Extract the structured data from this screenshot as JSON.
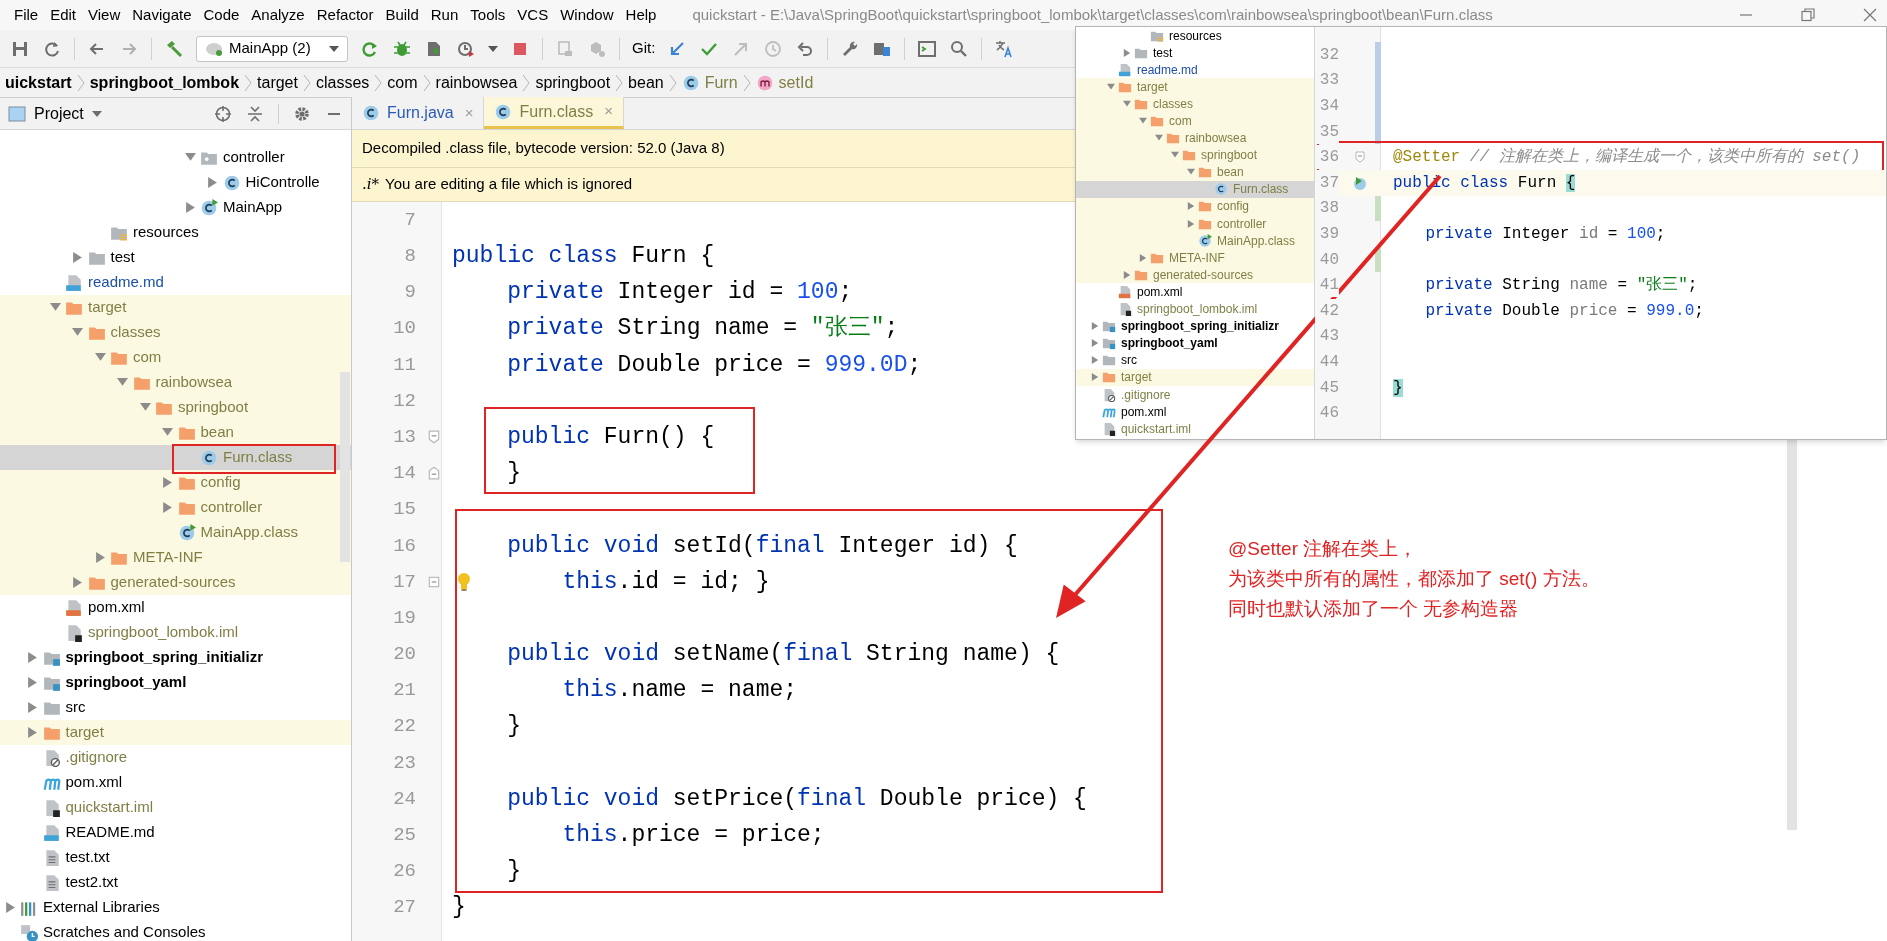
{
  "menu": [
    {
      "label": "File"
    },
    {
      "label": "Edit"
    },
    {
      "label": "View"
    },
    {
      "label": "Navigate"
    },
    {
      "label": "Code"
    },
    {
      "label": "Analyze"
    },
    {
      "label": "Refactor"
    },
    {
      "label": "Build"
    },
    {
      "label": "Run"
    },
    {
      "label": "Tools"
    },
    {
      "label": "VCS"
    },
    {
      "label": "Window"
    },
    {
      "label": "Help"
    }
  ],
  "window_title": "quickstart - E:\\Java\\SpringBoot\\quickstart\\springboot_lombok\\target\\classes\\com\\rainbowsea\\springboot\\bean\\Furn.class",
  "toolbar": {
    "run_config": "MainApp (2)",
    "git_label": "Git:"
  },
  "breadcrumbs": [
    {
      "label": "uickstart",
      "kind": "module"
    },
    {
      "label": "springboot_lombok",
      "kind": "module"
    },
    {
      "label": "target",
      "kind": "folder"
    },
    {
      "label": "classes",
      "kind": "folder"
    },
    {
      "label": "com",
      "kind": "folder"
    },
    {
      "label": "rainbowsea",
      "kind": "folder"
    },
    {
      "label": "springboot",
      "kind": "folder"
    },
    {
      "label": "bean",
      "kind": "folder"
    },
    {
      "label": "Furn",
      "kind": "class"
    },
    {
      "label": "setId",
      "kind": "method"
    }
  ],
  "project_panel": {
    "title": "Project",
    "tree": [
      {
        "children": [
          {
            "children": [
              {
                "children": [
                  {
                    "children": [
                      {
                        "children": [
                          {
                            "children": [
                              {
                                "children": [
                                  {
                                    "children": [
                                      {
                                        "label": "controller",
                                        "kind": "package",
                                        "expanded": true,
                                        "selected": false,
                                        "children": [
                                          {
                                            "label": "HiControlle",
                                            "kind": "class",
                                            "expanded": false,
                                            "selected": false
                                          }
                                        ]
                                      },
                                      {
                                        "label": "MainApp",
                                        "kind": "main-class",
                                        "expanded": false,
                                        "selected": false
                                      }
                                    ]
                                  }
                                ]
                              }
                            ]
                          }
                        ]
                      },
                      {
                        "label": "resources",
                        "kind": "resources-folder",
                        "selected": false
                      }
                    ]
                  },
                  {
                    "label": "test",
                    "kind": "folder",
                    "expanded": false,
                    "selected": false
                  }
                ]
              },
              {
                "label": "readme.md",
                "kind": "markdown",
                "vcs_added": true,
                "selected": false
              },
              {
                "label": "target",
                "kind": "folder",
                "excluded": true,
                "expanded": true,
                "selected": false,
                "children": [
                  {
                    "label": "classes",
                    "kind": "folder",
                    "excluded": true,
                    "expanded": true,
                    "selected": false,
                    "children": [
                      {
                        "label": "com",
                        "kind": "folder",
                        "excluded": true,
                        "expanded": true,
                        "selected": false,
                        "children": [
                          {
                            "label": "rainbowsea",
                            "kind": "folder",
                            "excluded": true,
                            "expanded": true,
                            "selected": false,
                            "children": [
                              {
                                "label": "springboot",
                                "kind": "folder",
                                "excluded": true,
                                "expanded": true,
                                "selected": false,
                                "children": [
                                  {
                                    "label": "bean",
                                    "kind": "folder",
                                    "excluded": true,
                                    "expanded": true,
                                    "selected": false,
                                    "children": [
                                      {
                                        "label": "Furn.class",
                                        "kind": "class",
                                        "excluded": true,
                                        "selected": true
                                      }
                                    ]
                                  },
                                  {
                                    "label": "config",
                                    "kind": "folder",
                                    "excluded": true,
                                    "expanded": false,
                                    "selected": false
                                  },
                                  {
                                    "label": "controller",
                                    "kind": "folder",
                                    "excluded": true,
                                    "expanded": false,
                                    "selected": false
                                  },
                                  {
                                    "label": "MainApp.class",
                                    "kind": "main-class",
                                    "excluded": true,
                                    "selected": false
                                  }
                                ]
                              }
                            ]
                          }
                        ]
                      },
                      {
                        "label": "META-INF",
                        "kind": "folder",
                        "excluded": true,
                        "expanded": false,
                        "selected": false
                      }
                    ]
                  },
                  {
                    "label": "generated-sources",
                    "kind": "folder",
                    "excluded": true,
                    "expanded": false,
                    "selected": false
                  }
                ]
              },
              {
                "label": "pom.xml",
                "kind": "xml",
                "selected": false
              },
              {
                "label": "springboot_lombok.iml",
                "kind": "iml",
                "ignored": true,
                "selected": false
              }
            ]
          },
          {
            "label": "springboot_spring_initializr",
            "kind": "module",
            "expanded": false,
            "selected": false
          },
          {
            "label": "springboot_yaml",
            "kind": "module",
            "expanded": false,
            "selected": false
          },
          {
            "label": "src",
            "kind": "folder",
            "expanded": false,
            "selected": false
          },
          {
            "label": "target",
            "kind": "folder",
            "excluded": true,
            "expanded": false,
            "selected": false
          },
          {
            "label": ".gitignore",
            "kind": "gitignore",
            "ignored": true,
            "selected": false
          },
          {
            "label": "pom.xml",
            "kind": "maven",
            "selected": false
          },
          {
            "label": "quickstart.iml",
            "kind": "iml",
            "ignored": true,
            "selected": false
          },
          {
            "label": "README.md",
            "kind": "markdown",
            "selected": false
          },
          {
            "label": "test.txt",
            "kind": "text",
            "selected": false
          },
          {
            "label": "test2.txt",
            "kind": "text",
            "selected": false
          }
        ]
      },
      {
        "label": "External Libraries",
        "kind": "libraries",
        "expanded": false,
        "selected": false
      },
      {
        "label": "Scratches and Consoles",
        "kind": "scratches",
        "selected": false
      }
    ]
  },
  "editor_tabs": [
    {
      "label": "Furn.java",
      "vcs_modified": true,
      "selected": false,
      "close": "×"
    },
    {
      "label": "Furn.class",
      "ignored": true,
      "selected": true,
      "close": "×"
    }
  ],
  "banners": [
    {
      "text": "Decompiled .class file, bytecode version: 52.0 (Java 8)"
    },
    {
      "prefix": ".i*",
      "text": "You are editing a file which is ignored"
    }
  ],
  "editor": {
    "lines": [
      {
        "number": "7"
      },
      {
        "number": "8",
        "segments": [
          {
            "kind": "keyword",
            "text": "public class"
          },
          {
            "kind": "plain",
            "text": " Furn {"
          }
        ]
      },
      {
        "number": "9",
        "segments": [
          {
            "kind": "keyword",
            "text": "    private"
          },
          {
            "kind": "plain",
            "text": " Integer id = "
          },
          {
            "kind": "number",
            "text": "100"
          },
          {
            "kind": "plain",
            "text": ";"
          }
        ]
      },
      {
        "number": "10",
        "segments": [
          {
            "kind": "keyword",
            "text": "    private"
          },
          {
            "kind": "plain",
            "text": " String name = "
          },
          {
            "kind": "string",
            "text": "\"张三\""
          },
          {
            "kind": "plain",
            "text": ";"
          }
        ]
      },
      {
        "number": "11",
        "segments": [
          {
            "kind": "keyword",
            "text": "    private"
          },
          {
            "kind": "plain",
            "text": " Double price = "
          },
          {
            "kind": "number",
            "text": "999.0D"
          },
          {
            "kind": "plain",
            "text": ";"
          }
        ]
      },
      {
        "number": "12"
      },
      {
        "number": "13",
        "fold_start": true,
        "segments": [
          {
            "kind": "keyword",
            "text": "    public"
          },
          {
            "kind": "plain",
            "text": " Furn() {"
          }
        ]
      },
      {
        "number": "14",
        "fold_end": true,
        "segments": [
          {
            "kind": "plain",
            "text": "    }"
          }
        ]
      },
      {
        "number": "15"
      },
      {
        "number": "16",
        "segments": [
          {
            "kind": "keyword",
            "text": "    public void"
          },
          {
            "kind": "plain",
            "text": " setId("
          },
          {
            "kind": "keyword",
            "text": "final"
          },
          {
            "kind": "plain",
            "text": " Integer id) {"
          }
        ]
      },
      {
        "number": "17",
        "folded": true,
        "bulb": true,
        "segments": [
          {
            "kind": "keyword",
            "text": "        this"
          },
          {
            "kind": "plain",
            "text": ".id = id; }"
          }
        ]
      },
      {
        "number": "19"
      },
      {
        "number": "20",
        "segments": [
          {
            "kind": "keyword",
            "text": "    public void"
          },
          {
            "kind": "plain",
            "text": " setName("
          },
          {
            "kind": "keyword",
            "text": "final"
          },
          {
            "kind": "plain",
            "text": " String name) {"
          }
        ]
      },
      {
        "number": "21",
        "segments": [
          {
            "kind": "keyword",
            "text": "        this"
          },
          {
            "kind": "plain",
            "text": ".name = name;"
          }
        ]
      },
      {
        "number": "22",
        "segments": [
          {
            "kind": "plain",
            "text": "    }"
          }
        ]
      },
      {
        "number": "23"
      },
      {
        "number": "24",
        "segments": [
          {
            "kind": "keyword",
            "text": "    public void"
          },
          {
            "kind": "plain",
            "text": " setPrice("
          },
          {
            "kind": "keyword",
            "text": "final"
          },
          {
            "kind": "plain",
            "text": " Double price) {"
          }
        ]
      },
      {
        "number": "25",
        "segments": [
          {
            "kind": "keyword",
            "text": "        this"
          },
          {
            "kind": "plain",
            "text": ".price = price;"
          }
        ]
      },
      {
        "number": "26",
        "segments": [
          {
            "kind": "plain",
            "text": "    }"
          }
        ]
      },
      {
        "number": "27",
        "segments": [
          {
            "kind": "plain",
            "text": "}"
          }
        ]
      }
    ]
  },
  "inset": {
    "tree": [
      {
        "children": [
          {
            "children": [
              {
                "children": [
                  {
                    "children": [
                      {
                        "label": "resources",
                        "kind": "resources-folder",
                        "selected": false
                      }
                    ]
                  },
                  {
                    "label": "test",
                    "kind": "folder",
                    "expanded": false,
                    "selected": false
                  }
                ]
              },
              {
                "label": "readme.md",
                "kind": "markdown",
                "vcs_added": true,
                "selected": false
              },
              {
                "label": "target",
                "kind": "folder",
                "excluded": true,
                "expanded": true,
                "selected": false,
                "children": [
                  {
                    "label": "classes",
                    "kind": "folder",
                    "excluded": true,
                    "expanded": true,
                    "selected": false,
                    "children": [
                      {
                        "label": "com",
                        "kind": "folder",
                        "excluded": true,
                        "expanded": true,
                        "selected": false,
                        "children": [
                          {
                            "label": "rainbowsea",
                            "kind": "folder",
                            "excluded": true,
                            "expanded": true,
                            "selected": false,
                            "children": [
                              {
                                "label": "springboot",
                                "kind": "folder",
                                "excluded": true,
                                "expanded": true,
                                "selected": false,
                                "children": [
                                  {
                                    "label": "bean",
                                    "kind": "folder",
                                    "excluded": true,
                                    "expanded": true,
                                    "selected": false,
                                    "children": [
                                      {
                                        "label": "Furn.class",
                                        "kind": "class",
                                        "excluded": true,
                                        "selected": true
                                      }
                                    ]
                                  },
                                  {
                                    "label": "config",
                                    "kind": "folder",
                                    "excluded": true,
                                    "expanded": false,
                                    "selected": false
                                  },
                                  {
                                    "label": "controller",
                                    "kind": "folder",
                                    "excluded": true,
                                    "expanded": false,
                                    "selected": false
                                  },
                                  {
                                    "label": "MainApp.class",
                                    "kind": "main-class",
                                    "excluded": true,
                                    "selected": false
                                  }
                                ]
                              }
                            ]
                          }
                        ]
                      },
                      {
                        "label": "META-INF",
                        "kind": "folder",
                        "excluded": true,
                        "expanded": false,
                        "selected": false
                      }
                    ]
                  },
                  {
                    "label": "generated-sources",
                    "kind": "folder",
                    "excluded": true,
                    "expanded": false,
                    "selected": false
                  }
                ]
              },
              {
                "label": "pom.xml",
                "kind": "xml",
                "selected": false
              },
              {
                "label": "springboot_lombok.iml",
                "kind": "iml",
                "ignored": true,
                "selected": false
              }
            ]
          },
          {
            "label": "springboot_spring_initializr",
            "kind": "module",
            "expanded": false,
            "selected": false
          },
          {
            "label": "springboot_yaml",
            "kind": "module",
            "expanded": false,
            "selected": false
          },
          {
            "label": "src",
            "kind": "folder",
            "expanded": false,
            "selected": false
          },
          {
            "label": "target",
            "kind": "folder",
            "excluded": true,
            "expanded": false,
            "selected": false
          },
          {
            "label": ".gitignore",
            "kind": "gitignore",
            "ignored": true,
            "selected": false
          },
          {
            "label": "pom.xml",
            "kind": "maven",
            "selected": false
          },
          {
            "label": "quickstart.iml",
            "kind": "iml",
            "ignored": true,
            "selected": false
          }
        ]
      }
    ],
    "lines": [
      {
        "number": "32",
        "vcs_modified": true
      },
      {
        "number": "33",
        "vcs_modified": true
      },
      {
        "number": "34",
        "vcs_modified": true
      },
      {
        "number": "35",
        "vcs_modified": true
      },
      {
        "number": "36",
        "fold_start": true,
        "segments": [
          {
            "kind": "annotation",
            "text": "@Setter"
          },
          {
            "kind": "comment",
            "text": " // 注解在类上，编译生成一个，该类中所有的 set()"
          }
        ]
      },
      {
        "number": "37",
        "current": true,
        "run_marker": true,
        "segments": [
          {
            "kind": "keyword",
            "text": "public class"
          },
          {
            "kind": "plain",
            "text": " Furn "
          },
          {
            "kind": "brace",
            "text": "{"
          }
        ]
      },
      {
        "number": "38",
        "vcs_added": true
      },
      {
        "number": "39",
        "segments": [
          {
            "kind": "keyword",
            "text": "    private"
          },
          {
            "kind": "plain",
            "text": " Integer "
          },
          {
            "kind": "unused",
            "text": "id"
          },
          {
            "kind": "plain",
            "text": " = "
          },
          {
            "kind": "number",
            "text": "100"
          },
          {
            "kind": "plain",
            "text": ";"
          }
        ]
      },
      {
        "number": "40",
        "vcs_added": true
      },
      {
        "number": "41",
        "segments": [
          {
            "kind": "keyword",
            "text": "    private"
          },
          {
            "kind": "plain",
            "text": " String "
          },
          {
            "kind": "unused",
            "text": "name"
          },
          {
            "kind": "plain",
            "text": " = "
          },
          {
            "kind": "string",
            "text": "\"张三\""
          },
          {
            "kind": "plain",
            "text": ";"
          }
        ]
      },
      {
        "number": "42",
        "segments": [
          {
            "kind": "keyword",
            "text": "    private"
          },
          {
            "kind": "plain",
            "text": " Double "
          },
          {
            "kind": "unused",
            "text": "price"
          },
          {
            "kind": "plain",
            "text": " = "
          },
          {
            "kind": "number",
            "text": "999.0"
          },
          {
            "kind": "plain",
            "text": ";"
          }
        ]
      },
      {
        "number": "43"
      },
      {
        "number": "44"
      },
      {
        "number": "45",
        "segments": [
          {
            "kind": "brace",
            "text": "}"
          }
        ]
      },
      {
        "number": "46"
      }
    ]
  },
  "annotation": {
    "lines": [
      "@Setter 注解在类上，",
      "为该类中所有的属性，都添加了 set() 方法。",
      "同时也默认添加了一个 无参构造器"
    ]
  }
}
